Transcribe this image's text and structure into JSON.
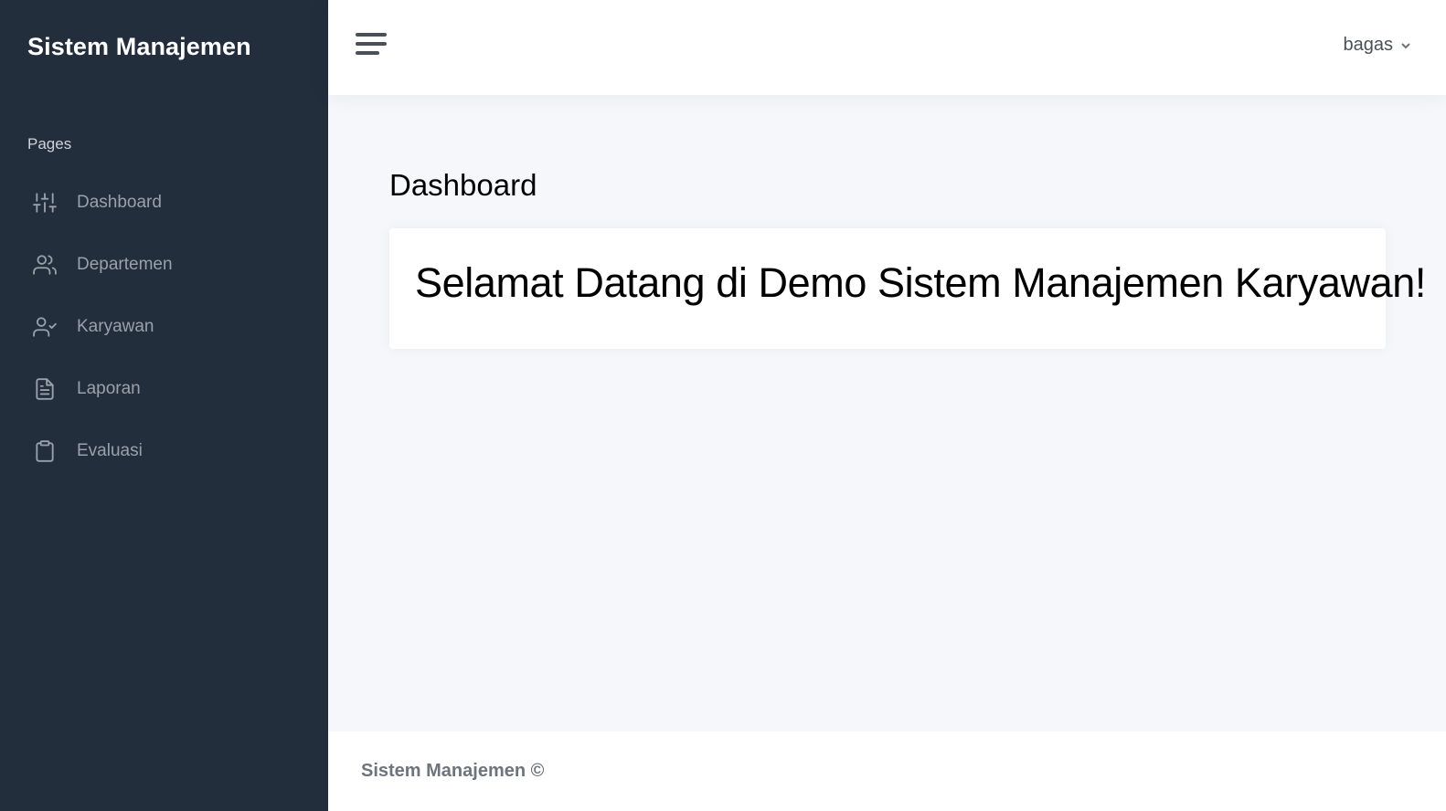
{
  "sidebar": {
    "brand": "Sistem Manajemen",
    "section_header": "Pages",
    "items": [
      {
        "label": "Dashboard",
        "icon": "sliders-icon"
      },
      {
        "label": "Departemen",
        "icon": "users-icon"
      },
      {
        "label": "Karyawan",
        "icon": "user-check-icon"
      },
      {
        "label": "Laporan",
        "icon": "file-text-icon"
      },
      {
        "label": "Evaluasi",
        "icon": "clipboard-icon"
      }
    ]
  },
  "topbar": {
    "menu_icon": "hamburger-icon",
    "username": "bagas",
    "dropdown_icon": "chevron-down-icon"
  },
  "main": {
    "page_title": "Dashboard",
    "welcome_message": "Selamat Datang di Demo Sistem Manajemen Karyawan!"
  },
  "footer": {
    "text": "Sistem Manajemen ©"
  },
  "colors": {
    "sidebar_bg": "#222e3c",
    "main_bg": "#f5f7fb",
    "nav_text": "#9aa1a9"
  }
}
